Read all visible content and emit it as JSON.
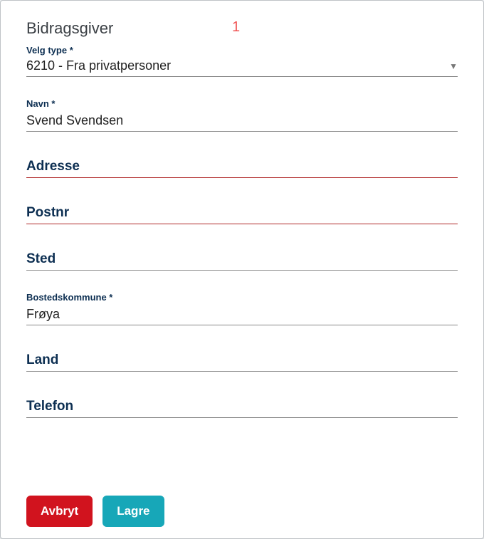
{
  "header": {
    "title": "Bidragsgiver",
    "badge": "1"
  },
  "form": {
    "type": {
      "label": "Velg type *",
      "value": "6210 - Fra privatpersoner"
    },
    "name": {
      "label": "Navn *",
      "value": "Svend Svendsen"
    },
    "address": {
      "label": "Adresse"
    },
    "postnr": {
      "label": "Postnr"
    },
    "sted": {
      "label": "Sted"
    },
    "municipality": {
      "label": "Bostedskommune *",
      "value": "Frøya"
    },
    "land": {
      "label": "Land"
    },
    "telefon": {
      "label": "Telefon"
    }
  },
  "footer": {
    "cancel": "Avbryt",
    "save": "Lagre"
  }
}
